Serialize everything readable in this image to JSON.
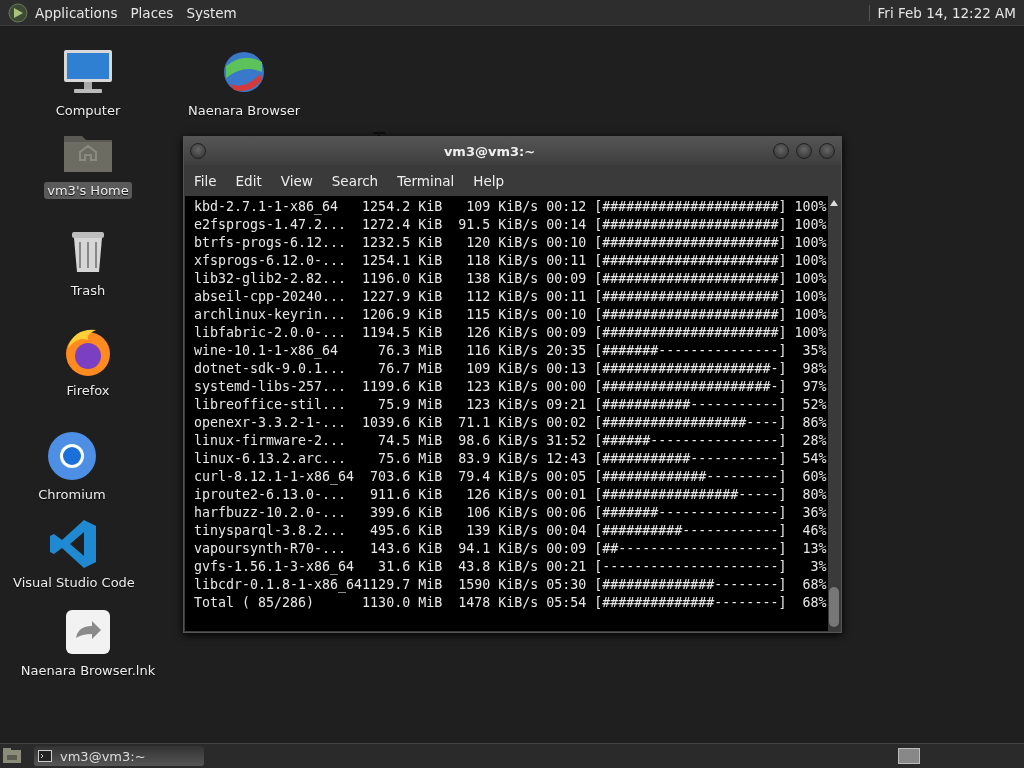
{
  "top_panel": {
    "menus": [
      "Applications",
      "Places",
      "System"
    ],
    "clock": "Fri Feb 14, 12:22 AM"
  },
  "desktop_icons": [
    {
      "kind": "computer",
      "label": "Computer",
      "selected": false
    },
    {
      "kind": "globe",
      "label": "Naenara Browser",
      "selected": false
    },
    {
      "kind": "home",
      "label": "vm3's Home",
      "selected": true
    },
    {
      "kind": "trash",
      "label": "Trash",
      "selected": false
    },
    {
      "kind": "firefox",
      "label": "Firefox",
      "selected": false
    },
    {
      "kind": "chromium",
      "label": "Chromium",
      "selected": false
    },
    {
      "kind": "vscode",
      "label": "Visual Studio Code",
      "selected": false
    },
    {
      "kind": "link",
      "label": "Naenara Browser.lnk",
      "selected": false
    }
  ],
  "terminal": {
    "title": "vm3@vm3:~",
    "menus": [
      "File",
      "Edit",
      "View",
      "Search",
      "Terminal",
      "Help"
    ],
    "lines": [
      "kbd-2.7.1-1-x86_64   1254.2 KiB   109 KiB/s 00:12 [######################] 100%",
      "e2fsprogs-1.47.2...  1272.4 KiB  91.5 KiB/s 00:14 [######################] 100%",
      "btrfs-progs-6.12...  1232.5 KiB   120 KiB/s 00:10 [######################] 100%",
      "xfsprogs-6.12.0-...  1254.1 KiB   118 KiB/s 00:11 [######################] 100%",
      "lib32-glib2-2.82...  1196.0 KiB   138 KiB/s 00:09 [######################] 100%",
      "abseil-cpp-20240...  1227.9 KiB   112 KiB/s 00:11 [######################] 100%",
      "archlinux-keyrin...  1206.9 KiB   115 KiB/s 00:10 [######################] 100%",
      "libfabric-2.0.0-...  1194.5 KiB   126 KiB/s 00:09 [######################] 100%",
      "wine-10.1-1-x86_64     76.3 MiB   116 KiB/s 20:35 [#######---------------]  35%",
      "dotnet-sdk-9.0.1...    76.7 MiB   109 KiB/s 00:13 [#####################-]  98%",
      "systemd-libs-257...  1199.6 KiB   123 KiB/s 00:00 [#####################-]  97%",
      "libreoffice-stil...    75.9 MiB   123 KiB/s 09:21 [###########-----------]  52%",
      "openexr-3.3.2-1-...  1039.6 KiB  71.1 KiB/s 00:02 [##################----]  86%",
      "linux-firmware-2...    74.5 MiB  98.6 KiB/s 31:52 [######----------------]  28%",
      "linux-6.13.2.arc...    75.6 MiB  83.9 KiB/s 12:43 [###########-----------]  54%",
      "curl-8.12.1-1-x86_64  703.6 KiB  79.4 KiB/s 00:05 [#############---------]  60%",
      "iproute2-6.13.0-...   911.6 KiB   126 KiB/s 00:01 [#################-----]  80%",
      "harfbuzz-10.2.0-...   399.6 KiB   106 KiB/s 00:06 [#######---------------]  36%",
      "tinysparql-3.8.2...   495.6 KiB   139 KiB/s 00:04 [##########------------]  46%",
      "vapoursynth-R70-...   143.6 KiB  94.1 KiB/s 00:09 [##--------------------]  13%",
      "gvfs-1.56.1-3-x86_64   31.6 KiB  43.8 KiB/s 00:21 [----------------------]   3%",
      "libcdr-0.1.8-1-x86_641129.7 MiB  1590 KiB/s 05:30 [##############--------]  68%",
      "Total ( 85/286)      1130.0 MiB  1478 KiB/s 05:54 [##############--------]  68%"
    ]
  },
  "taskbar": {
    "tasks": [
      {
        "label": "vm3@vm3:~",
        "selected": false
      }
    ]
  }
}
